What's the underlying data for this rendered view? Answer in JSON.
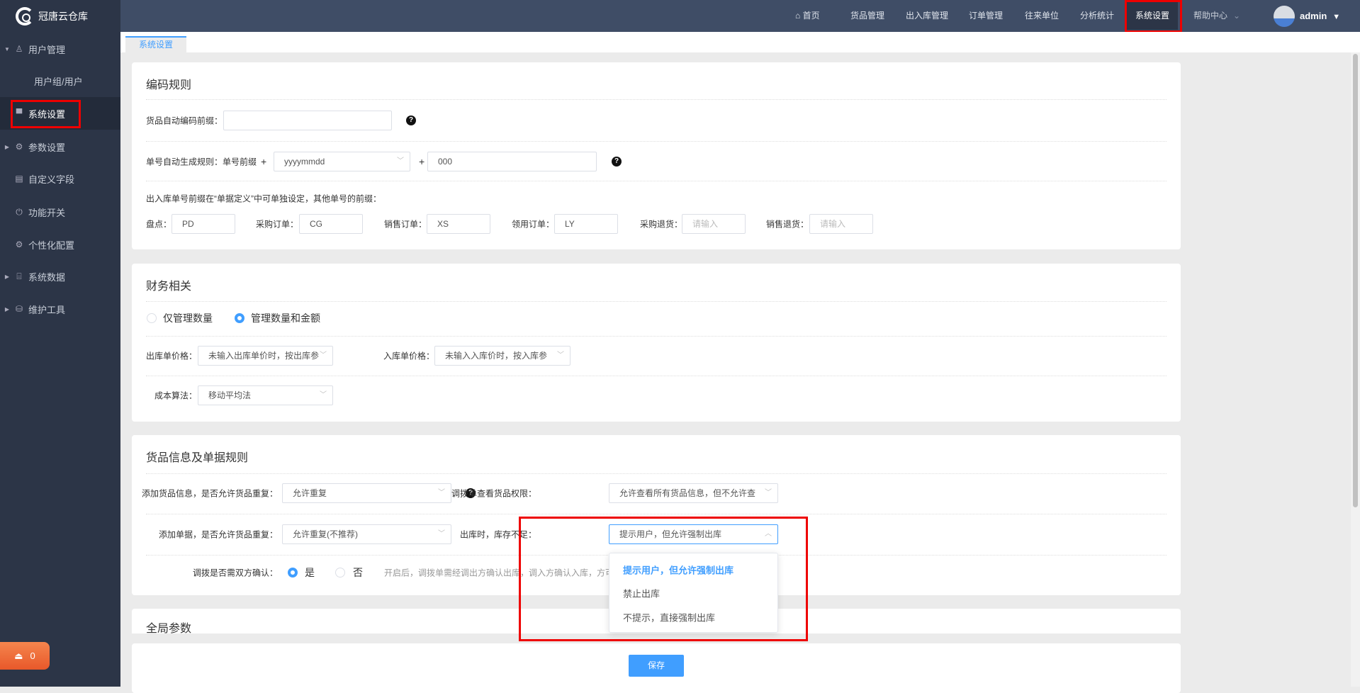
{
  "app": {
    "name": "冠唐云仓库"
  },
  "sidebar": {
    "items": [
      {
        "label": "用户管理",
        "icon": "user-icon",
        "expanded": true
      },
      {
        "label": "用户组/用户"
      },
      {
        "label": "系统设置",
        "icon": "monitor-icon",
        "active": true
      },
      {
        "label": "参数设置",
        "icon": "gear-icon"
      },
      {
        "label": "自定义字段",
        "icon": "form-icon"
      },
      {
        "label": "功能开关",
        "icon": "power-icon"
      },
      {
        "label": "个性化配置",
        "icon": "gear-icon"
      },
      {
        "label": "系统数据",
        "icon": "chart-board-icon"
      },
      {
        "label": "维护工具",
        "icon": "database-icon"
      }
    ],
    "alarm_count": "0"
  },
  "header": {
    "nav": [
      "首页",
      "货品管理",
      "出入库管理",
      "订单管理",
      "往来单位",
      "分析统计",
      "系统设置",
      "帮助中心"
    ],
    "active": "系统设置",
    "user": "admin"
  },
  "tab": "系统设置",
  "coding": {
    "title": "编码规则",
    "auto_prefix_label": "货品自动编码前缀：",
    "auto_prefix_value": "",
    "order_rule_label": "单号自动生成规则：单号前缀",
    "plus": "+",
    "date_format": "yyyymmdd",
    "serial": "000",
    "note": "出入库单号前缀在“单据定义”中可单独设定，其他单号的前缀：",
    "prefixes": [
      {
        "label": "盘点：",
        "value": "PD"
      },
      {
        "label": "采购订单：",
        "value": "CG"
      },
      {
        "label": "销售订单：",
        "value": "XS"
      },
      {
        "label": "领用订单：",
        "value": "LY"
      },
      {
        "label": "采购退货：",
        "placeholder": "请输入"
      },
      {
        "label": "销售退货：",
        "placeholder": "请输入"
      }
    ]
  },
  "finance": {
    "title": "财务相关",
    "mode_options": [
      "仅管理数量",
      "管理数量和金额"
    ],
    "mode_selected": "管理数量和金额",
    "out_price_label": "出库单价格：",
    "out_price_value": "未输入出库单价时，按出库参",
    "in_price_label": "入库单价格：",
    "in_price_value": "未输入入库价时，按入库参",
    "cost_label": "成本算法：",
    "cost_value": "移动平均法"
  },
  "goods": {
    "title": "货品信息及单据规则",
    "dup_goods_label": "添加货品信息，是否允许货品重复：",
    "dup_goods_value": "允许重复",
    "transfer_view_label": "调拨单查看货品权限：",
    "transfer_view_value": "允许查看所有货品信息，但不允许查",
    "dup_doc_label": "添加单据，是否允许货品重复：",
    "dup_doc_value": "允许重复(不推荐)",
    "shortage_label": "出库时，库存不足：",
    "shortage_value": "提示用户，但允许强制出库",
    "shortage_options": [
      "提示用户，但允许强制出库",
      "禁止出库",
      "不提示，直接强制出库"
    ],
    "confirm_label": "调拨是否需双方确认：",
    "confirm_yes": "是",
    "confirm_no": "否",
    "confirm_selected": "是",
    "confirm_hint": "开启后，调拨单需经调出方确认出库，调入方确认入库，方可"
  },
  "global": {
    "title": "全局参数"
  },
  "save_label": "保存"
}
